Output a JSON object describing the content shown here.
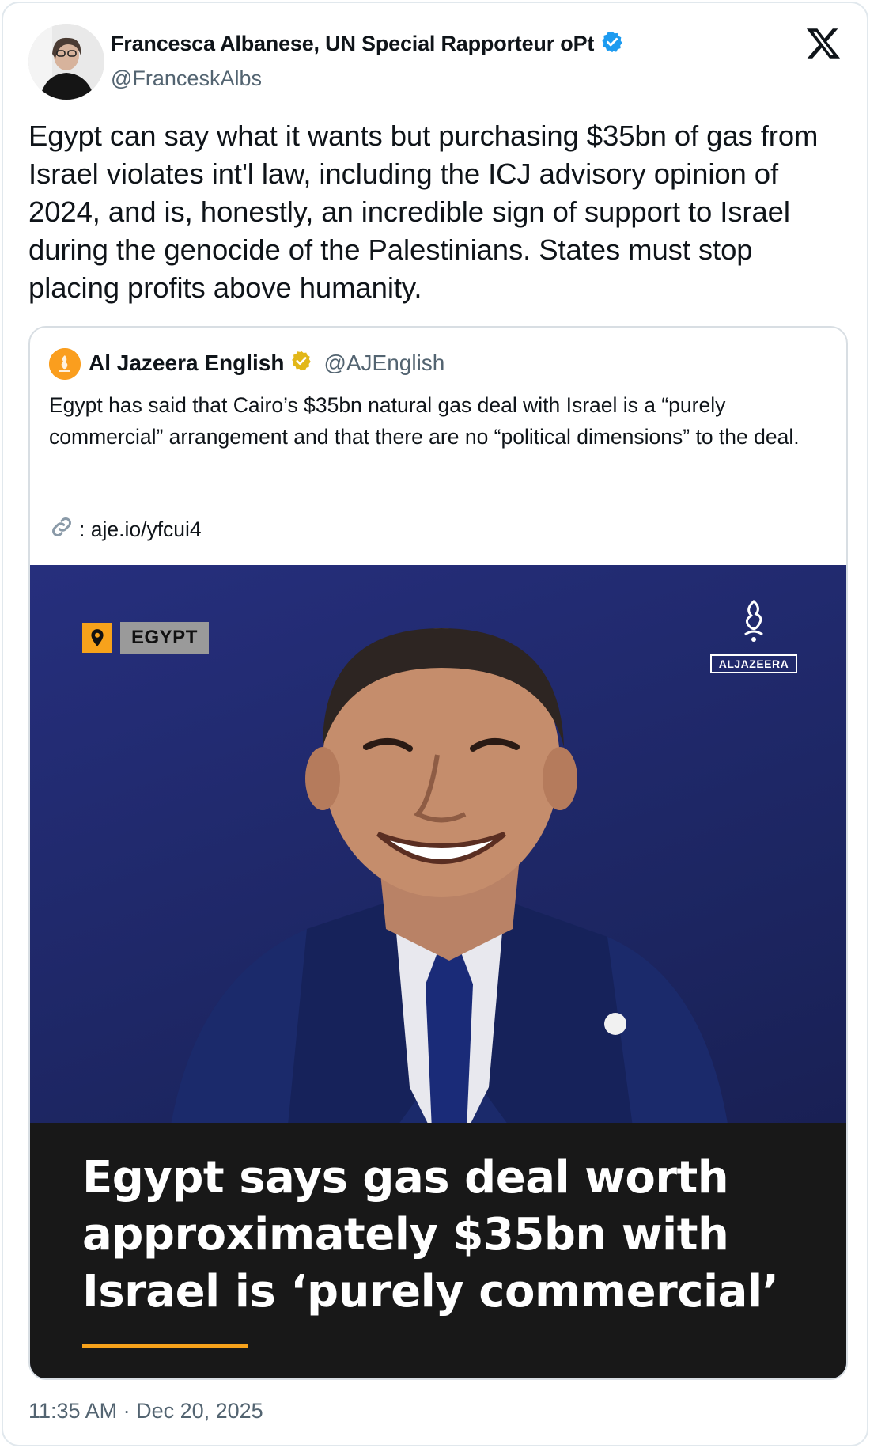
{
  "author": {
    "display_name": "Francesca Albanese, UN Special Rapporteur oPt",
    "handle": "@FranceskAlbs",
    "verified_color": "#1d9bf0"
  },
  "tweet": {
    "text": "Egypt can say what it wants but purchasing $35bn of gas from Israel violates int'l law, including the ICJ advisory opinion of 2024, and is, honestly, an incredible sign of support to Israel during the genocide of the Palestinians. States must stop placing profits above humanity.",
    "timestamp": "11:35 AM · Dec 20, 2025"
  },
  "quote": {
    "display_name": "Al Jazeera English",
    "handle": "@AJEnglish",
    "verified_color": "#e2b719",
    "text": "Egypt has said that Cairo’s $35bn natural gas deal with Israel is a “purely commercial” arrangement and that there are no “political dimensions” to the deal.",
    "link_text": ": aje.io/yfcui4",
    "media": {
      "tag_label": "EGYPT",
      "brand_wordmark": "ALJAZEERA",
      "headline": "Egypt says gas deal worth approximately $35bn with Israel is ‘purely commercial’",
      "accent_color": "#f7a21b"
    }
  },
  "icons": {
    "platform": "x-logo-icon",
    "verified": "verified-badge-icon",
    "link": "link-icon"
  }
}
